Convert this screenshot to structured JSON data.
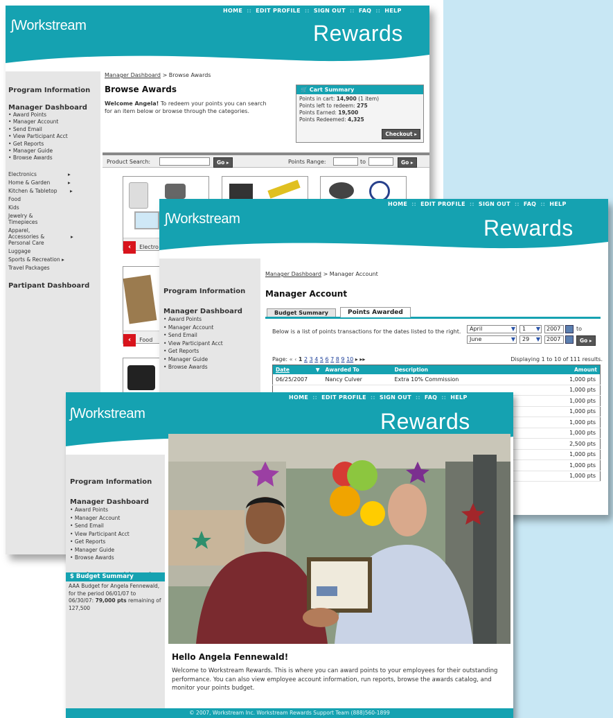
{
  "brand": {
    "logo": "Workstream",
    "title": "Rewards"
  },
  "nav": [
    "HOME",
    "EDIT PROFILE",
    "SIGN OUT",
    "FAQ",
    "HELP"
  ],
  "sidebar": {
    "program_info": "Program Information",
    "manager_dashboard": "Manager Dashboard",
    "items": [
      "Award Points",
      "Manager Account",
      "Send Email",
      "View Participant Acct",
      "Get Reports",
      "Manager Guide",
      "Browse Awards"
    ],
    "participant_dashboard": "Partipant Dashboard",
    "categories": [
      "Electronics",
      "Home & Garden",
      "Kitchen & Tabletop",
      "Food",
      "Kids",
      "Jewelry & Timepieces",
      "Apparel, Accessories & Personal Care",
      "Luggage",
      "Sports & Recreation",
      "Travel Packages"
    ]
  },
  "win1": {
    "breadcrumb_link": "Manager Dashboard",
    "breadcrumb_rest": "> Browse Awards",
    "title": "Browse Awards",
    "welcome_bold": "Welcome Angela!",
    "welcome_text": "To redeem your points you can search for an item below or browse through the categories.",
    "cart": {
      "title": "Cart Summary",
      "in_cart_label": "Points in cart:",
      "in_cart": "14,900",
      "in_cart_note": "(1 item)",
      "left_label": "Points left to redeem:",
      "left": "275",
      "earned_label": "Points Earned:",
      "earned": "19,500",
      "redeemed_label": "Points Redeemed:",
      "redeemed": "4,325",
      "checkout": "Checkout"
    },
    "search_label": "Product Search:",
    "go": "Go",
    "range_label": "Points Range:",
    "range_to": "to",
    "categories_shown": [
      "Electro",
      "Food"
    ]
  },
  "win2": {
    "breadcrumb_link": "Manager Dashboard",
    "breadcrumb_rest": "> Manager Account",
    "title": "Manager Account",
    "tabs": [
      "Budget Summary",
      "Points Awarded"
    ],
    "desc": "Below is a list of points transactions for the dates listed to the right.",
    "from": {
      "month": "April",
      "day": "1",
      "year": "2007"
    },
    "to_label": "to",
    "to": {
      "month": "June",
      "day": "29",
      "year": "2007"
    },
    "go": "Go",
    "page_label": "Page:",
    "pages": [
      "1",
      "2",
      "3",
      "4",
      "5",
      "6",
      "7",
      "8",
      "9",
      "10"
    ],
    "displaying": "Displaying 1 to 10 of 111 results.",
    "columns": [
      "Date",
      "Awarded To",
      "Description",
      "Amount"
    ],
    "rows": [
      {
        "date": "06/25/2007",
        "to": "Nancy Culver",
        "desc": "Extra 10% Commission",
        "amount": "1,000 pts"
      },
      {
        "date": "",
        "to": "",
        "desc": "",
        "amount": "1,000 pts"
      },
      {
        "date": "",
        "to": "",
        "desc": "",
        "amount": "1,000 pts"
      },
      {
        "date": "",
        "to": "",
        "desc": "",
        "amount": "1,000 pts"
      },
      {
        "date": "",
        "to": "",
        "desc": "",
        "amount": "1,000 pts"
      },
      {
        "date": "",
        "to": "",
        "desc": "",
        "amount": "1,000 pts"
      },
      {
        "date": "",
        "to": "",
        "desc": "",
        "amount": "2,500 pts"
      },
      {
        "date": "",
        "to": "",
        "desc": "",
        "amount": "1,000 pts"
      },
      {
        "date": "",
        "to": "",
        "desc": "",
        "amount": "1,000 pts"
      },
      {
        "date": "",
        "to": "",
        "desc": "",
        "amount": "1,000 pts"
      }
    ]
  },
  "win3": {
    "hello": "Hello Angela Fennewald!",
    "welcome": "Welcome to Workstream Rewards. This is where you can award points to your employees for their outstanding performance. You can also view employee account information, run reports, browse the awards catalog, and monitor your points budget.",
    "budget": {
      "title": "Budget Summary",
      "line1": "AAA Budget for Angela Fennewald, for the period 06/01/07 to 06/30/07:",
      "points": "79,000 pts",
      "remaining": "remaining of 127,500"
    },
    "footer": "© 2007, Workstream Inc. Workstream Rewards Support Team (888)560-1899"
  }
}
